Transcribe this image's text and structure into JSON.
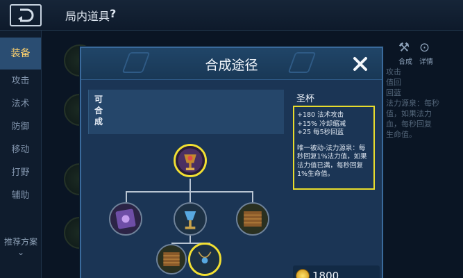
{
  "topbar": {
    "title": "局内道具",
    "help": "?"
  },
  "sidebar": {
    "items": [
      {
        "label": "装备",
        "active": true
      },
      {
        "label": "攻击"
      },
      {
        "label": "法术"
      },
      {
        "label": "防御"
      },
      {
        "label": "移动"
      },
      {
        "label": "打野"
      },
      {
        "label": "辅助"
      }
    ],
    "plan": "推荐方案"
  },
  "background": {
    "right_labels": [
      "合成",
      "详情"
    ],
    "right_text": "攻击\n值回\n回蓝\n法力源泉：每秒\n值，如果法力\n血，每秒回复\n生命值。"
  },
  "modal": {
    "title": "合成途径",
    "close": "✕",
    "strip_label": "可\n合\n成",
    "item_name": "圣杯",
    "stats": [
      "+180 法术攻击",
      "+15% 冷却缩减",
      "+25 每5秒回蓝"
    ],
    "passive": "唯一被动-法力源泉：每秒回复1%法力值，如果法力值已满，每秒回复1%生命值。",
    "price": "1800"
  }
}
